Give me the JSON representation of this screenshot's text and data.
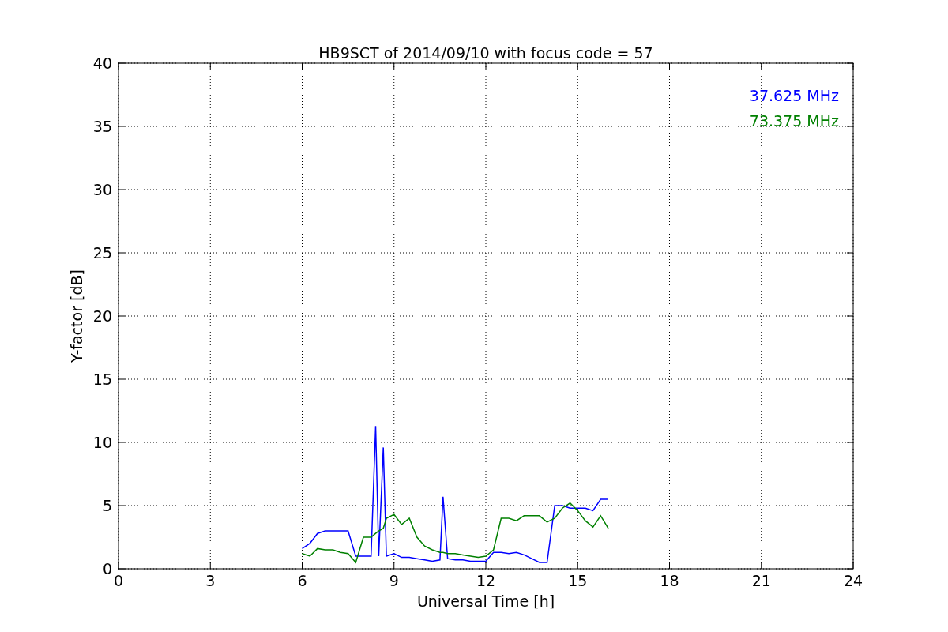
{
  "chart_data": {
    "type": "line",
    "title": "HB9SCT of 2014/09/10 with focus code = 57",
    "xlabel": "Universal Time [h]",
    "ylabel": "Y-factor [dB]",
    "x": [
      6.0,
      6.25,
      6.5,
      6.75,
      7.0,
      7.25,
      7.5,
      7.75,
      8.0,
      8.25,
      8.4,
      8.5,
      8.65,
      8.75,
      9.0,
      9.25,
      9.5,
      9.75,
      10.0,
      10.25,
      10.5,
      10.6,
      10.75,
      11.0,
      11.25,
      11.5,
      11.75,
      12.0,
      12.25,
      12.5,
      12.75,
      13.0,
      13.25,
      13.5,
      13.75,
      14.0,
      14.25,
      14.5,
      14.75,
      15.0,
      15.25,
      15.5,
      15.75,
      16.0
    ],
    "series": [
      {
        "name": "37.625 MHz",
        "color": "#0000ff",
        "values": [
          1.6,
          2.0,
          2.8,
          3.0,
          3.0,
          3.0,
          3.0,
          1.0,
          1.0,
          1.0,
          11.3,
          1.0,
          9.6,
          1.0,
          1.2,
          0.9,
          0.9,
          0.8,
          0.7,
          0.6,
          0.7,
          5.7,
          0.8,
          0.7,
          0.7,
          0.6,
          0.6,
          0.6,
          1.3,
          1.3,
          1.2,
          1.3,
          1.1,
          0.8,
          0.5,
          0.5,
          5.0,
          5.0,
          4.8,
          4.8,
          4.8,
          4.6,
          5.5,
          5.5
        ]
      },
      {
        "name": "73.375 MHz",
        "color": "#008000",
        "values": [
          1.2,
          1.0,
          1.6,
          1.5,
          1.5,
          1.3,
          1.2,
          0.5,
          2.5,
          2.5,
          2.8,
          3.0,
          3.2,
          4.0,
          4.3,
          3.5,
          4.0,
          2.5,
          1.8,
          1.5,
          1.3,
          1.3,
          1.2,
          1.2,
          1.1,
          1.0,
          0.9,
          1.0,
          1.5,
          4.0,
          4.0,
          3.8,
          4.2,
          4.2,
          4.2,
          3.7,
          4.0,
          4.8,
          5.2,
          4.6,
          3.8,
          3.3,
          4.2,
          3.2
        ]
      }
    ],
    "grid": true,
    "xlim": [
      0,
      24
    ],
    "ylim": [
      0,
      40
    ],
    "xticks": [
      0,
      3,
      6,
      9,
      12,
      15,
      18,
      21,
      24
    ],
    "yticks": [
      0,
      5,
      10,
      15,
      20,
      25,
      30,
      35,
      40
    ]
  }
}
